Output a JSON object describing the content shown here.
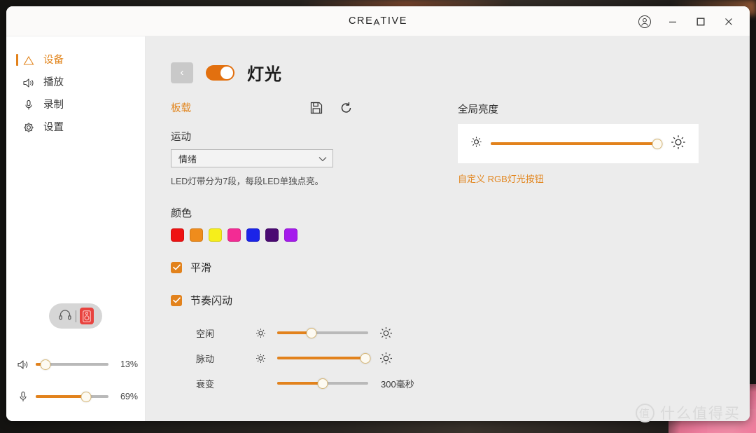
{
  "window": {
    "brand": "CREATIVE",
    "brand_parts": [
      "CRE",
      "A",
      "TIV",
      "E"
    ],
    "controls": {
      "account": "account-icon",
      "minimize": "minimize",
      "maximize": "maximize",
      "close": "close"
    }
  },
  "sidebar": {
    "items": [
      {
        "label": "设备",
        "icon": "device-triangle-icon",
        "active": true
      },
      {
        "label": "播放",
        "icon": "speaker-icon",
        "active": false
      },
      {
        "label": "录制",
        "icon": "microphone-icon",
        "active": false
      },
      {
        "label": "设置",
        "icon": "gear-icon",
        "active": false
      }
    ],
    "device_toggle": {
      "headphone_icon": "headphone-icon",
      "speaker_icon": "speaker-box-icon",
      "active": "speaker"
    },
    "volume": {
      "icon": "volume-icon",
      "value": 13,
      "display": "13%"
    },
    "mic": {
      "icon": "microphone-icon",
      "value": 69,
      "display": "69%"
    }
  },
  "main": {
    "back_button": "‹",
    "lighting_toggle_on": true,
    "title": "灯光",
    "tab": "板载",
    "actions": {
      "save": "save-icon",
      "reset": "reset-icon"
    },
    "motion": {
      "label": "运动",
      "selected": "情绪",
      "options": [
        "情绪"
      ],
      "hint": "LED灯带分为7段，每段LED单独点亮。"
    },
    "color": {
      "label": "颜色",
      "swatches": [
        "#ee1212",
        "#ef8c1c",
        "#f6ee1b",
        "#f32b94",
        "#1b24e8",
        "#4a0a72",
        "#a51bec"
      ]
    },
    "checkboxes": [
      {
        "label": "平滑",
        "checked": true
      },
      {
        "label": "节奏闪动",
        "checked": true
      }
    ],
    "sliders": [
      {
        "name": "空闲",
        "value": 38,
        "value_label": "",
        "left_icon": "sun-small-icon",
        "right_icon": "sun-large-icon"
      },
      {
        "name": "脉动",
        "value": 97,
        "value_label": "",
        "left_icon": "sun-small-icon",
        "right_icon": "sun-large-icon"
      },
      {
        "name": "衰变",
        "value": 50,
        "value_label": "300毫秒",
        "left_icon": "",
        "right_icon": ""
      }
    ],
    "brightness": {
      "label": "全局亮度",
      "value": 97,
      "left_icon": "sun-small-icon",
      "right_icon": "sun-large-icon",
      "link": "自定义 RGB灯光按钮"
    }
  },
  "watermark": {
    "mark": "值",
    "text": "什么值得买"
  },
  "colors": {
    "accent": "#e2821c",
    "toggle_on": "#e2700f",
    "panel_bg": "#ececec",
    "sidebar_bg": "#ffffff"
  }
}
